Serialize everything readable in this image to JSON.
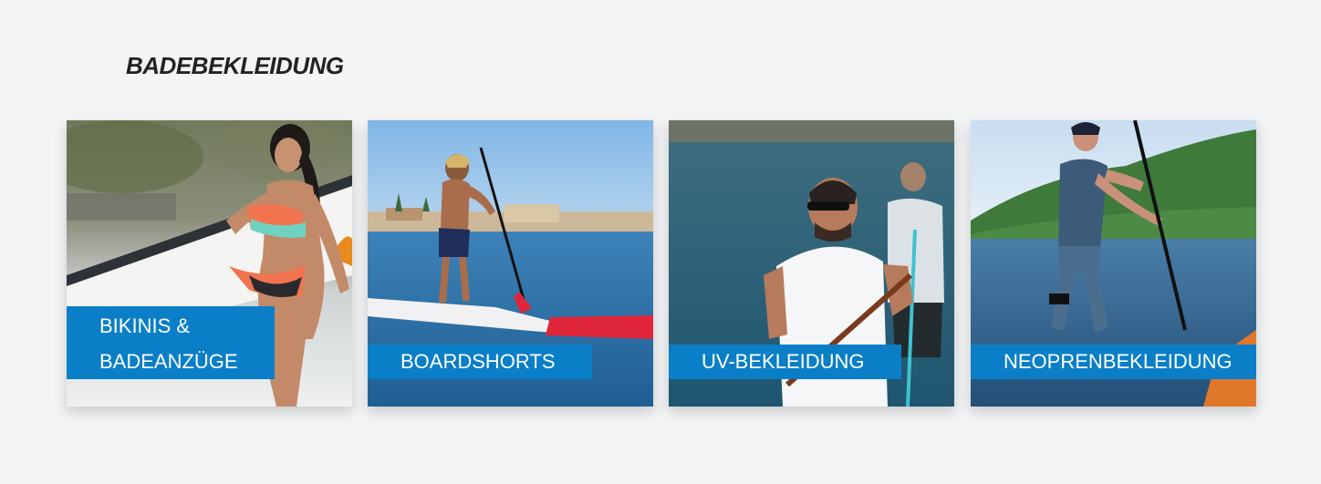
{
  "section": {
    "title": "BADEBEKLEIDUNG"
  },
  "cards": [
    {
      "label_line1": "BIKINIS &",
      "label_line2": "BADEANZÜGE"
    },
    {
      "label": "BOARDSHORTS"
    },
    {
      "label": "UV-BEKLEIDUNG"
    },
    {
      "label": "NEOPRENBEKLEIDUNG"
    }
  ],
  "colors": {
    "accent": "#0a7fc7",
    "background": "#f3f4f6",
    "title": "#222222"
  }
}
